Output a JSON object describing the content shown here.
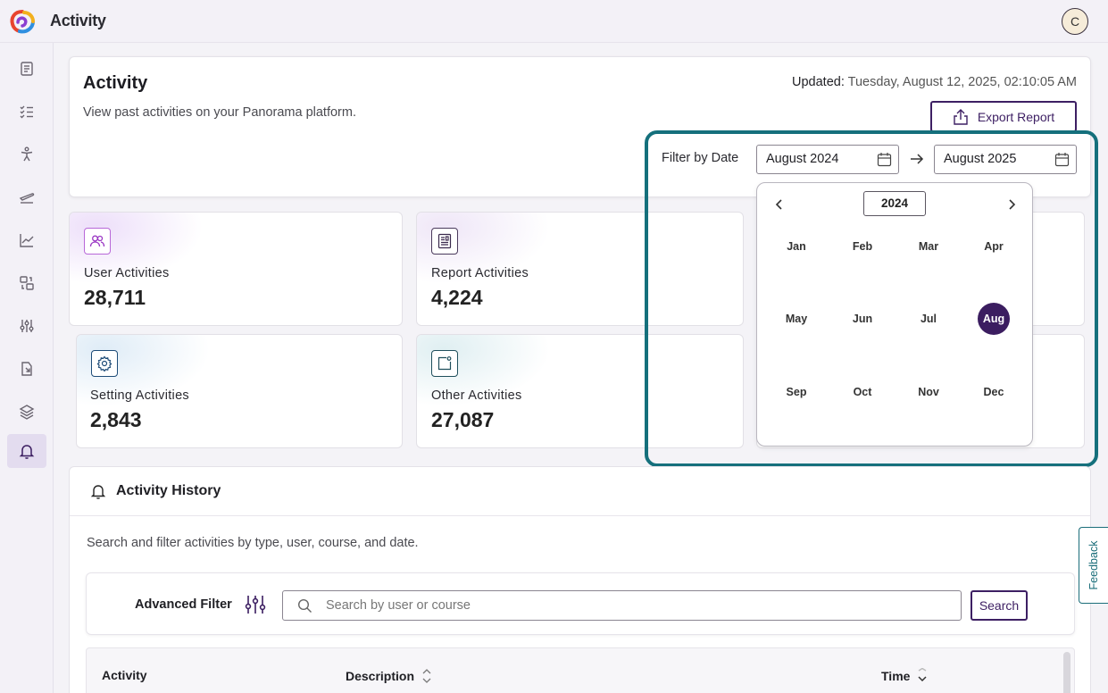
{
  "app": {
    "title": "Activity",
    "user_initial": "C"
  },
  "header": {
    "title": "Activity",
    "subtitle": "View past activities on your Panorama platform.",
    "updated_label": "Updated:",
    "updated_value": "Tuesday, August 12, 2025, 02:10:05 AM",
    "export_label": "Export Report"
  },
  "filter": {
    "label": "Filter by Date",
    "from": "August 2024",
    "to": "August 2025"
  },
  "picker": {
    "year": "2024",
    "months": [
      "Jan",
      "Feb",
      "Mar",
      "Apr",
      "May",
      "Jun",
      "Jul",
      "Aug",
      "Sep",
      "Oct",
      "Nov",
      "Dec"
    ],
    "selected": "Aug"
  },
  "stats": [
    {
      "label": "User Activities",
      "value": "28,711",
      "icon": "users-icon"
    },
    {
      "label": "Report Activities",
      "value": "4,224",
      "icon": "report-icon"
    },
    {
      "label": "Setting Activities",
      "value": "2,843",
      "icon": "gear-icon"
    },
    {
      "label": "Other Activities",
      "value": "27,087",
      "icon": "other-icon"
    }
  ],
  "history": {
    "title": "Activity History",
    "description": "Search and filter activities by type, user, course, and date.",
    "advanced_filter_label": "Advanced Filter",
    "search_placeholder": "Search by user or course",
    "search_button": "Search",
    "columns": [
      "Activity",
      "Description",
      "Time"
    ]
  },
  "feedback_label": "Feedback",
  "colors": {
    "accent": "#3b1d60",
    "highlight": "#15707c"
  }
}
